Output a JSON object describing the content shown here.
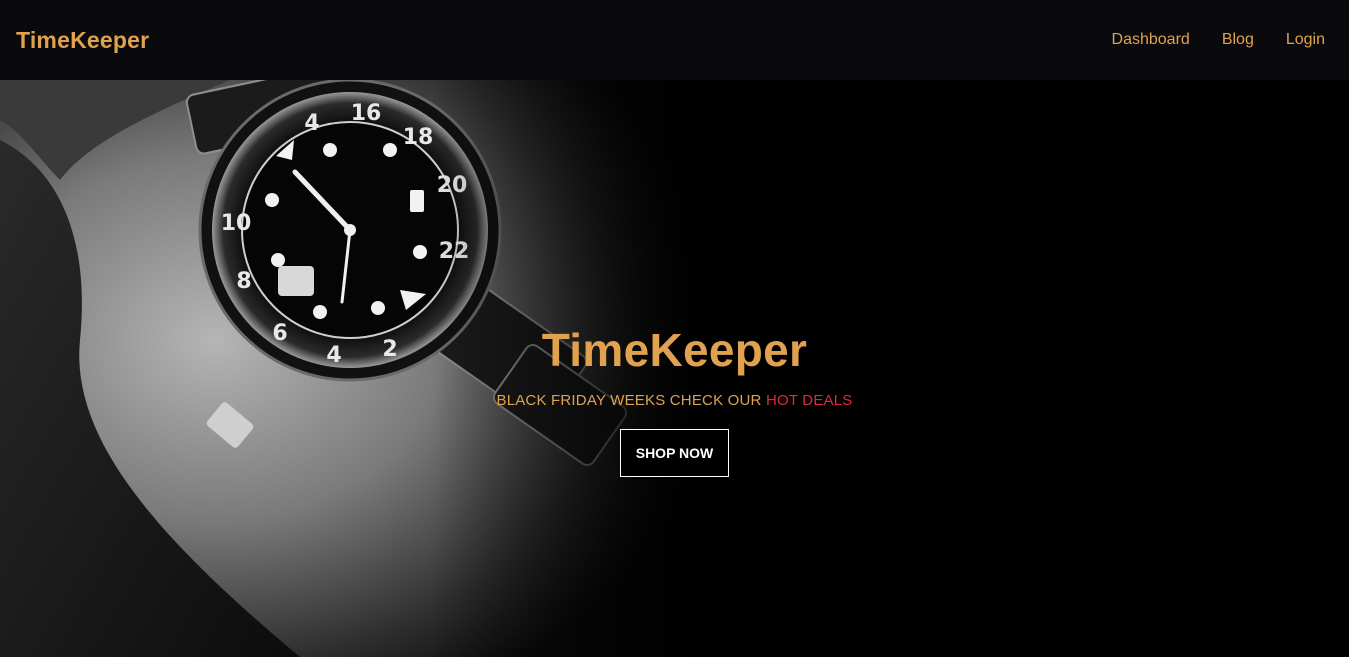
{
  "navbar": {
    "brand": "TimeKeeper",
    "links": [
      "Dashboard",
      "Blog",
      "Login"
    ]
  },
  "hero": {
    "image_description_icon": "wristwatch-photo",
    "title": "TimeKeeper",
    "subtitle_prefix": "BLACK FRIDAY WEEKS CHECK OUR ",
    "subtitle_highlight": "HOT DEALS",
    "cta_label": "SHOP NOW"
  },
  "watch_bezel_numbers": [
    "4",
    "16",
    "18",
    "20",
    "22",
    "2",
    "4",
    "6",
    "8",
    "10"
  ],
  "colors": {
    "accent": "#e0a24f",
    "highlight": "#e0283a",
    "nav_bg": "#0a0a0c",
    "hero_bg": "#000000"
  }
}
